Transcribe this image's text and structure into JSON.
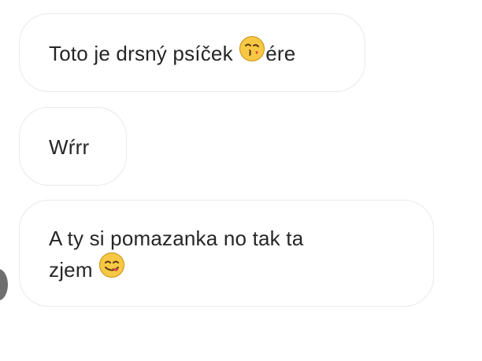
{
  "messages": [
    {
      "text_before": "Toto je drsný psíček ",
      "emoji": "face-blowing-kiss-icon",
      "text_after": "ére"
    },
    {
      "text": "Wŕrr"
    },
    {
      "line1": "A ty si pomazanka no tak ta",
      "line2": "zjem ",
      "emoji": "face-savoring-food-icon"
    }
  ],
  "colors": {
    "bubble_border": "#e9e9e9",
    "text": "#262626",
    "emoji_yellow": "#f7c844"
  }
}
